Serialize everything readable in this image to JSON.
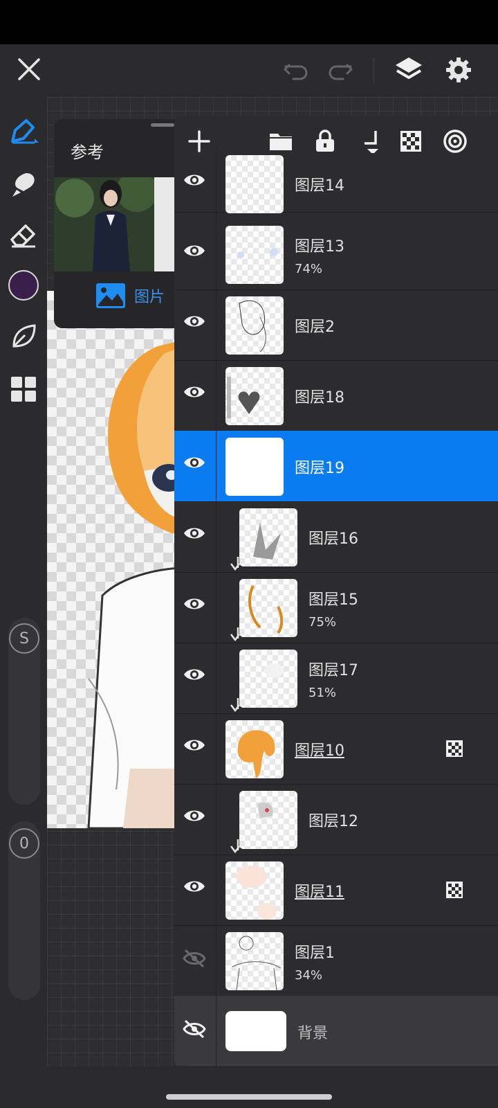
{
  "reference": {
    "title": "参考",
    "image_button_label": "图片"
  },
  "layers": [
    {
      "name": "图层14",
      "opacity": "",
      "visible": true,
      "clipped": false,
      "mask": false,
      "underline": false,
      "selected": false
    },
    {
      "name": "图层13",
      "opacity": "74%",
      "visible": true,
      "clipped": false,
      "mask": false,
      "underline": false,
      "selected": false
    },
    {
      "name": "图层2",
      "opacity": "",
      "visible": true,
      "clipped": false,
      "mask": false,
      "underline": false,
      "selected": false
    },
    {
      "name": "图层18",
      "opacity": "",
      "visible": true,
      "clipped": false,
      "mask": false,
      "underline": false,
      "selected": false
    },
    {
      "name": "图层19",
      "opacity": "",
      "visible": true,
      "clipped": false,
      "mask": false,
      "underline": false,
      "selected": true
    },
    {
      "name": "图层16",
      "opacity": "",
      "visible": true,
      "clipped": true,
      "mask": false,
      "underline": false,
      "selected": false
    },
    {
      "name": "图层15",
      "opacity": "75%",
      "visible": true,
      "clipped": true,
      "mask": false,
      "underline": false,
      "selected": false
    },
    {
      "name": "图层17",
      "opacity": "51%",
      "visible": true,
      "clipped": true,
      "mask": false,
      "underline": false,
      "selected": false
    },
    {
      "name": "图层10",
      "opacity": "",
      "visible": true,
      "clipped": false,
      "mask": true,
      "underline": true,
      "selected": false
    },
    {
      "name": "图层12",
      "opacity": "",
      "visible": true,
      "clipped": true,
      "mask": false,
      "underline": false,
      "selected": false
    },
    {
      "name": "图层11",
      "opacity": "",
      "visible": true,
      "clipped": false,
      "mask": true,
      "underline": true,
      "selected": false
    },
    {
      "name": "图层1",
      "opacity": "34%",
      "visible": false,
      "clipped": false,
      "mask": false,
      "underline": false,
      "selected": false
    },
    {
      "name": "背景",
      "opacity": "",
      "visible": false,
      "clipped": false,
      "mask": false,
      "underline": false,
      "selected": false,
      "background": true
    }
  ],
  "sliders": {
    "size_label": "S",
    "opacity_label": "0"
  },
  "colors": {
    "accent": "#0a7cf0",
    "current_color": "#3a1f4a",
    "panel": "#2c2c2e"
  },
  "icons": [
    "close-icon",
    "undo-icon",
    "redo-icon",
    "layers-icon",
    "settings-icon",
    "pen-icon",
    "smudge-icon",
    "eraser-icon",
    "color-swatch",
    "leaf-icon",
    "grid-icon",
    "add-icon",
    "folder-icon",
    "lock-icon",
    "merge-down-icon",
    "transparency-icon",
    "blend-icon",
    "eye-icon",
    "eye-off-icon",
    "clip-arrow-icon",
    "mask-icon",
    "image-icon"
  ]
}
